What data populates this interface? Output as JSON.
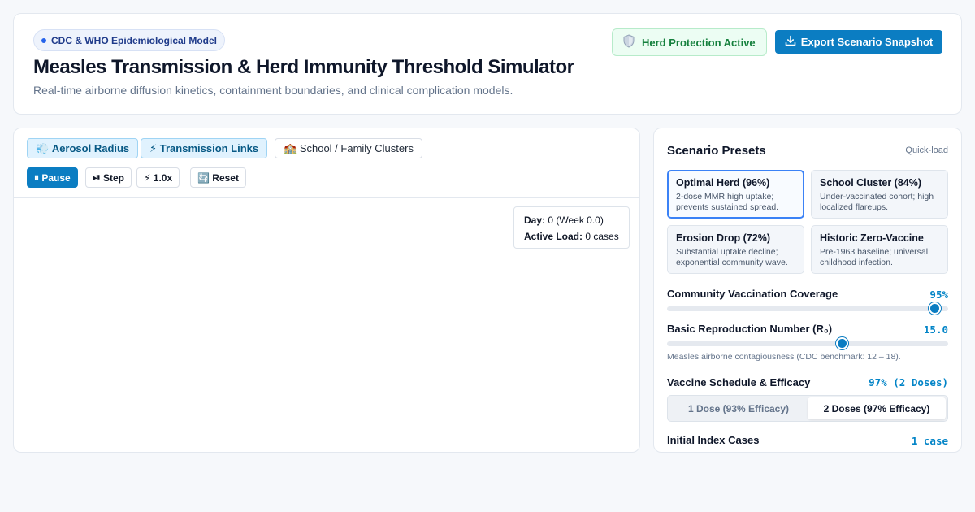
{
  "header": {
    "pill": "CDC & WHO Epidemiological Model",
    "title": "Measles Transmission & Herd Immunity Threshold Simulator",
    "subtitle": "Real-time airborne diffusion kinetics, containment boundaries, and clinical complication models.",
    "status_badge": {
      "icon": "shield-icon",
      "label": "Herd Protection Active"
    },
    "export_label": "Export Scenario Snapshot"
  },
  "simulation": {
    "toggles": [
      {
        "icon": "💨",
        "label": "Aerosol Radius",
        "active": true
      },
      {
        "icon": "⚡",
        "label": "Transmission Links",
        "active": true
      },
      {
        "icon": "🏫",
        "label": "School / Family Clusters",
        "active": false
      }
    ],
    "controls": {
      "pause": {
        "icon": "⏸",
        "label": "Pause"
      },
      "step": {
        "icon": "⏯",
        "label": "Step"
      },
      "speed": {
        "icon": "⚡",
        "label": "1.0x"
      },
      "reset": {
        "icon": "🔄",
        "label": "Reset"
      }
    },
    "hud": {
      "day_label": "Day:",
      "day_value": "0 (Week 0.0)",
      "load_label": "Active Load:",
      "load_value": "0 cases"
    }
  },
  "presets": {
    "title": "Scenario Presets",
    "quickload": "Quick-load",
    "items": [
      {
        "title": "Optimal Herd (96%)",
        "desc": "2-dose MMR high uptake; prevents sustained spread.",
        "selected": true
      },
      {
        "title": "School Cluster (84%)",
        "desc": "Under-vaccinated cohort; high localized flareups.",
        "selected": false
      },
      {
        "title": "Erosion Drop (72%)",
        "desc": "Substantial uptake decline; exponential community wave.",
        "selected": false
      },
      {
        "title": "Historic Zero-Vaccine",
        "desc": "Pre-1963 baseline; universal childhood infection.",
        "selected": false
      }
    ],
    "coverage": {
      "label": "Community Vaccination Coverage",
      "value": "95%",
      "level": 0.95
    },
    "r0": {
      "label": "Basic Reproduction Number (R₀)",
      "value": "15.0",
      "level": 0.62,
      "note": "Measles airborne contagiousness (CDC benchmark: 12 – 18)."
    },
    "schedule": {
      "label": "Vaccine Schedule & Efficacy",
      "value": "97% (2 Doses)",
      "options": [
        "1 Dose (93% Efficacy)",
        "2 Doses (97% Efficacy)"
      ],
      "selected_index": 1
    },
    "index_cases": {
      "label": "Initial Index Cases",
      "value": "1 case"
    }
  },
  "colors": {
    "accent": "#0b7dc2",
    "success": "#15803d",
    "selected_border": "#3b82f6"
  }
}
